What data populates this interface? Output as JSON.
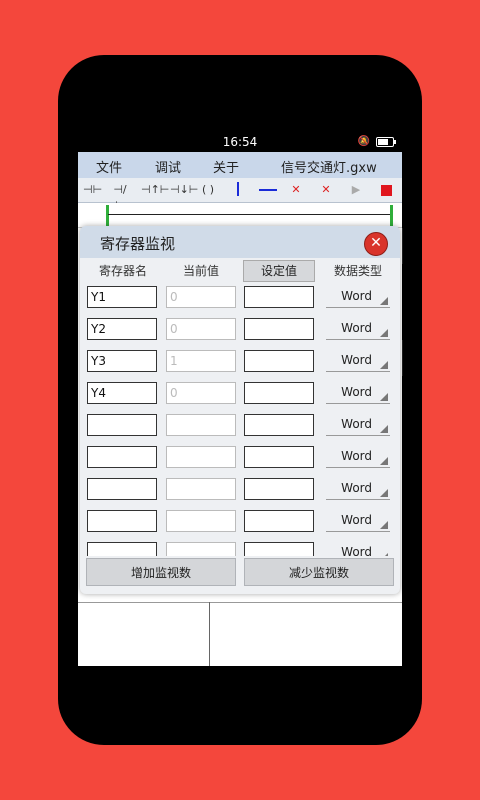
{
  "status": {
    "time": "16:54"
  },
  "menu": {
    "file": "文件",
    "debug": "调试",
    "about": "关于",
    "filename": "信号交通灯.gxw"
  },
  "dialog": {
    "title": "寄存器监视",
    "headers": {
      "name": "寄存器名",
      "current": "当前值",
      "set": "设定值",
      "type": "数据类型"
    },
    "rows": [
      {
        "name": "Y1",
        "current": "0",
        "set": "",
        "type": "Word"
      },
      {
        "name": "Y2",
        "current": "0",
        "set": "",
        "type": "Word"
      },
      {
        "name": "Y3",
        "current": "1",
        "set": "",
        "type": "Word"
      },
      {
        "name": "Y4",
        "current": "0",
        "set": "",
        "type": "Word"
      },
      {
        "name": "",
        "current": "",
        "set": "",
        "type": "Word"
      },
      {
        "name": "",
        "current": "",
        "set": "",
        "type": "Word"
      },
      {
        "name": "",
        "current": "",
        "set": "",
        "type": "Word"
      },
      {
        "name": "",
        "current": "",
        "set": "",
        "type": "Word"
      },
      {
        "name": "",
        "current": "",
        "set": "",
        "type": "Word"
      }
    ],
    "add_button": "增加监视数",
    "remove_button": "减少监视数"
  },
  "colors": {
    "background": "#f4473c",
    "title_bar": "#d0dbe8",
    "close": "#d9342b",
    "rail": "#2fae3a"
  },
  "icons": [
    "contact-no-icon",
    "contact-nc-icon",
    "contact-rise-icon",
    "contact-fall-icon",
    "coil-icon",
    "vertical-line-icon",
    "horizontal-line-icon",
    "delete-vertical-icon",
    "delete-horizontal-icon",
    "run-icon",
    "stop-icon"
  ]
}
